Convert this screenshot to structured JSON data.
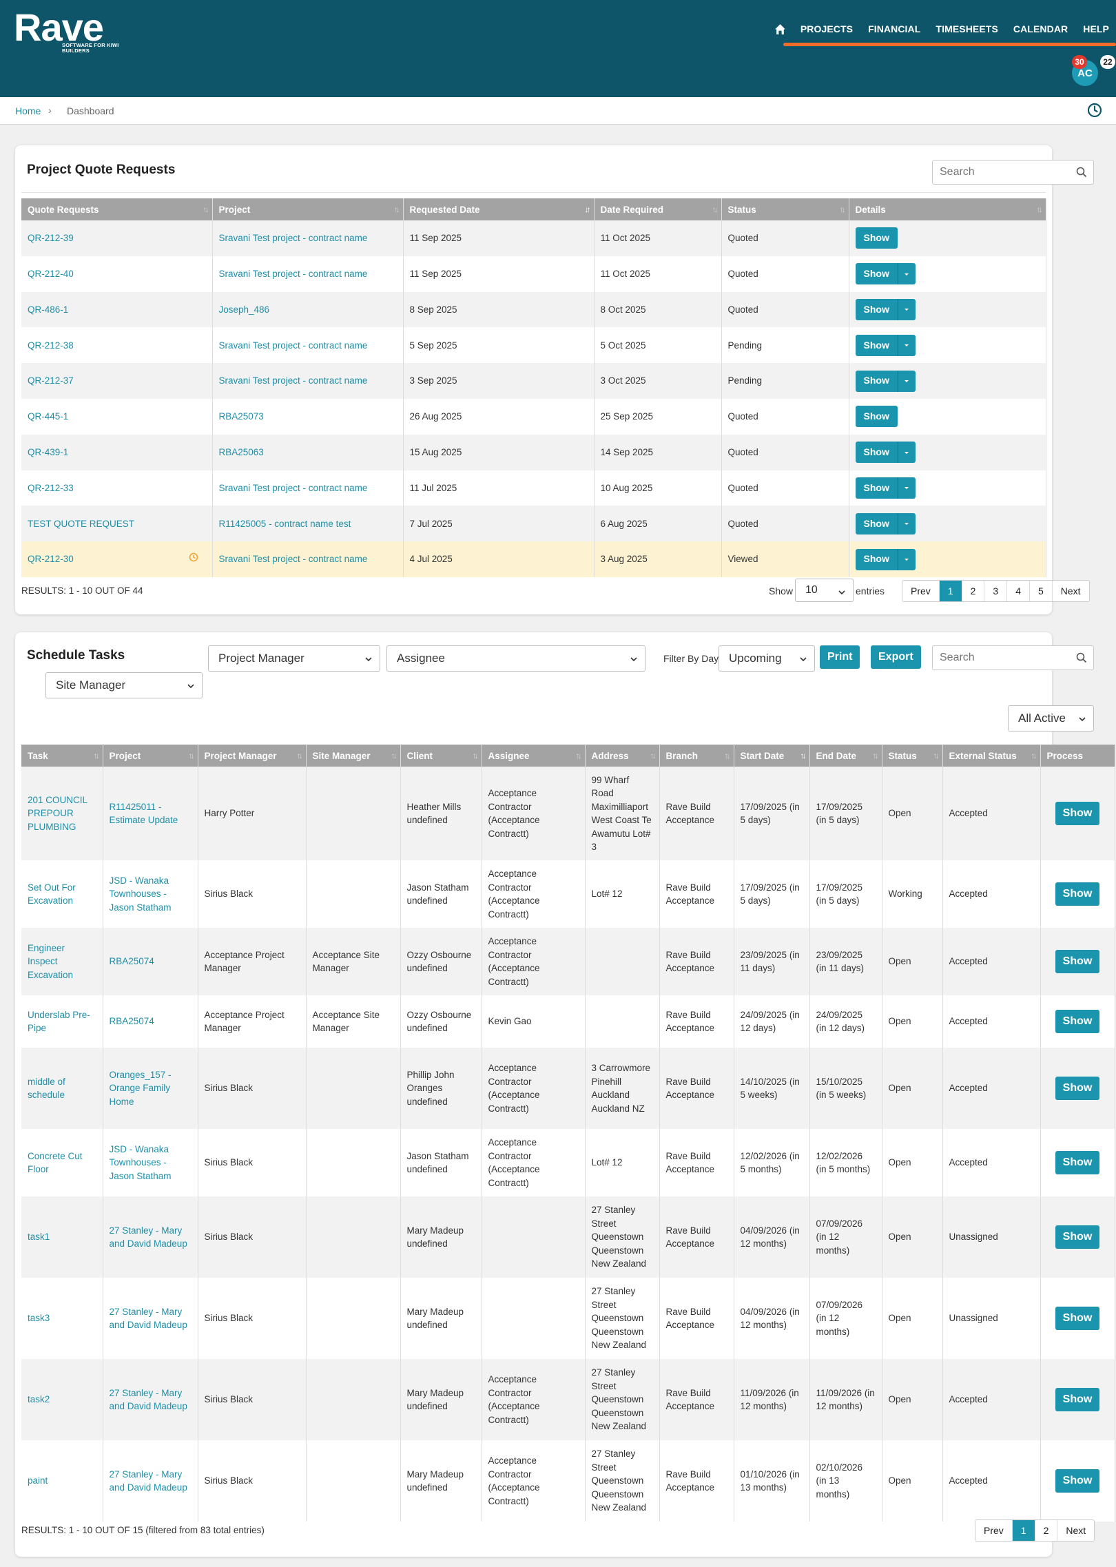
{
  "brand": {
    "name": "Rave",
    "tagline": "SOFTWARE FOR KIWI BUILDERS"
  },
  "nav": {
    "items": [
      "PROJECTS",
      "FINANCIAL",
      "TIMESHEETS",
      "CALENDAR",
      "HELP"
    ]
  },
  "user": {
    "initials": "AC",
    "notifications": "30",
    "messages": "22"
  },
  "breadcrumb": {
    "home": "Home",
    "current": "Dashboard"
  },
  "quotes": {
    "title": "Project Quote Requests",
    "search_placeholder": "Search",
    "columns": [
      "Quote Requests",
      "Project",
      "Requested Date",
      "Date Required",
      "Status",
      "Details"
    ],
    "show_label": "Show",
    "rows": [
      {
        "id": "QR-212-39",
        "project": "Sravani Test project - contract name",
        "requested": "11 Sep 2025",
        "required": "11 Oct 2025",
        "status": "Quoted",
        "caret": false
      },
      {
        "id": "QR-212-40",
        "project": "Sravani Test project - contract name",
        "requested": "11 Sep 2025",
        "required": "11 Oct 2025",
        "status": "Quoted",
        "caret": true
      },
      {
        "id": "QR-486-1",
        "project": "Joseph_486",
        "requested": "8 Sep 2025",
        "required": "8 Oct 2025",
        "status": "Quoted",
        "caret": true
      },
      {
        "id": "QR-212-38",
        "project": "Sravani Test project - contract name",
        "requested": "5 Sep 2025",
        "required": "5 Oct 2025",
        "status": "Pending",
        "caret": true
      },
      {
        "id": "QR-212-37",
        "project": "Sravani Test project - contract name",
        "requested": "3 Sep 2025",
        "required": "3 Oct 2025",
        "status": "Pending",
        "caret": true
      },
      {
        "id": "QR-445-1",
        "project": "RBA25073",
        "requested": "26 Aug 2025",
        "required": "25 Sep 2025",
        "status": "Quoted",
        "caret": false
      },
      {
        "id": "QR-439-1",
        "project": "RBA25063",
        "requested": "15 Aug 2025",
        "required": "14 Sep 2025",
        "status": "Quoted",
        "caret": true
      },
      {
        "id": "QR-212-33",
        "project": "Sravani Test project - contract name",
        "requested": "11 Jul 2025",
        "required": "10 Aug 2025",
        "status": "Quoted",
        "caret": true
      },
      {
        "id": "TEST QUOTE REQUEST",
        "project": "R11425005 - contract name test",
        "requested": "7 Jul 2025",
        "required": "6 Aug 2025",
        "status": "Quoted",
        "caret": true
      },
      {
        "id": "QR-212-30",
        "project": "Sravani Test project - contract name",
        "requested": "4 Jul 2025",
        "required": "3 Aug 2025",
        "status": "Viewed",
        "caret": true,
        "highlight": true,
        "clock": true
      }
    ],
    "results": "RESULTS: 1 - 10 OUT OF 44",
    "show_label_text": "Show",
    "entries_value": "10",
    "entries_label": "entries",
    "pager": [
      "Prev",
      "1",
      "2",
      "3",
      "4",
      "5",
      "Next"
    ],
    "pager_active": "1"
  },
  "tasks": {
    "title": "Schedule Tasks",
    "filters": {
      "project_manager": "Project Manager",
      "assignee": "Assignee",
      "filter_by_days_label": "Filter By Days",
      "days_value": "Upcoming",
      "site_manager": "Site Manager",
      "active_value": "All Active"
    },
    "print_label": "Print",
    "export_label": "Export",
    "search_placeholder": "Search",
    "columns": [
      "Task",
      "Project",
      "Project Manager",
      "Site Manager",
      "Client",
      "Assignee",
      "Address",
      "Branch",
      "Start Date",
      "End Date",
      "Status",
      "External Status",
      "Process"
    ],
    "show_label": "Show",
    "rows": [
      {
        "task": "201 COUNCIL PREPOUR PLUMBING",
        "project": "R11425011 - Estimate Update",
        "pm": "Harry Potter",
        "sm": "",
        "client": "Heather Mills undefined",
        "assignee": "Acceptance Contractor (Acceptance Contractt)",
        "address": "99 Wharf Road Maximilliaport West Coast Te Awamutu Lot# 3",
        "branch": "Rave Build Acceptance",
        "start": "17/09/2025 (in 5 days)",
        "end": "17/09/2025 (in 5 days)",
        "status": "Open",
        "ext": "Accepted"
      },
      {
        "task": "Set Out For Excavation",
        "project": "JSD - Wanaka Townhouses - Jason Statham",
        "pm": "Sirius Black",
        "sm": "",
        "client": "Jason Statham undefined",
        "assignee": "Acceptance Contractor (Acceptance Contractt)",
        "address": "Lot# 12",
        "branch": "Rave Build Acceptance",
        "start": "17/09/2025 (in 5 days)",
        "end": "17/09/2025 (in 5 days)",
        "status": "Working",
        "ext": "Accepted"
      },
      {
        "task": "Engineer Inspect Excavation",
        "project": "RBA25074",
        "pm": "Acceptance Project Manager",
        "sm": "Acceptance Site Manager",
        "client": "Ozzy Osbourne undefined",
        "assignee": "Acceptance Contractor (Acceptance Contractt)",
        "address": "",
        "branch": "Rave Build Acceptance",
        "start": "23/09/2025 (in 11 days)",
        "end": "23/09/2025 (in 11 days)",
        "status": "Open",
        "ext": "Accepted"
      },
      {
        "task": "Underslab Pre-Pipe",
        "project": "RBA25074",
        "pm": "Acceptance Project Manager",
        "sm": "Acceptance Site Manager",
        "client": "Ozzy Osbourne undefined",
        "assignee": "Kevin Gao",
        "address": "",
        "branch": "Rave Build Acceptance",
        "start": "24/09/2025 (in 12 days)",
        "end": "24/09/2025 (in 12 days)",
        "status": "Open",
        "ext": "Accepted"
      },
      {
        "task": "middle of schedule",
        "project": "Oranges_157 - Orange Family Home",
        "pm": "Sirius Black",
        "sm": "",
        "client": "Phillip John Oranges undefined",
        "assignee": "Acceptance Contractor (Acceptance Contractt)",
        "address": "3 Carrowmore Pinehill Auckland Auckland NZ",
        "branch": "Rave Build Acceptance",
        "start": "14/10/2025 (in 5 weeks)",
        "end": "15/10/2025 (in 5 weeks)",
        "status": "Open",
        "ext": "Accepted"
      },
      {
        "task": "Concrete Cut Floor",
        "project": "JSD - Wanaka Townhouses - Jason Statham",
        "pm": "Sirius Black",
        "sm": "",
        "client": "Jason Statham undefined",
        "assignee": "Acceptance Contractor (Acceptance Contractt)",
        "address": "Lot# 12",
        "branch": "Rave Build Acceptance",
        "start": "12/02/2026 (in 5 months)",
        "end": "12/02/2026 (in 5 months)",
        "status": "Open",
        "ext": "Accepted"
      },
      {
        "task": "task1",
        "project": "27 Stanley - Mary and David Madeup",
        "pm": "Sirius Black",
        "sm": "",
        "client": "Mary Madeup undefined",
        "assignee": "",
        "address": "27 Stanley Street Queenstown Queenstown New Zealand",
        "branch": "Rave Build Acceptance",
        "start": "04/09/2026 (in 12 months)",
        "end": "07/09/2026 (in 12 months)",
        "status": "Open",
        "ext": "Unassigned"
      },
      {
        "task": "task3",
        "project": "27 Stanley - Mary and David Madeup",
        "pm": "Sirius Black",
        "sm": "",
        "client": "Mary Madeup undefined",
        "assignee": "",
        "address": "27 Stanley Street Queenstown Queenstown New Zealand",
        "branch": "Rave Build Acceptance",
        "start": "04/09/2026 (in 12 months)",
        "end": "07/09/2026 (in 12 months)",
        "status": "Open",
        "ext": "Unassigned"
      },
      {
        "task": "task2",
        "project": "27 Stanley - Mary and David Madeup",
        "pm": "Sirius Black",
        "sm": "",
        "client": "Mary Madeup undefined",
        "assignee": "Acceptance Contractor (Acceptance Contractt)",
        "address": "27 Stanley Street Queenstown Queenstown New Zealand",
        "branch": "Rave Build Acceptance",
        "start": "11/09/2026 (in 12 months)",
        "end": "11/09/2026 (in 12 months)",
        "status": "Open",
        "ext": "Accepted"
      },
      {
        "task": "paint",
        "project": "27 Stanley - Mary and David Madeup",
        "pm": "Sirius Black",
        "sm": "",
        "client": "Mary Madeup undefined",
        "assignee": "Acceptance Contractor (Acceptance Contractt)",
        "address": "27 Stanley Street Queenstown Queenstown New Zealand",
        "branch": "Rave Build Acceptance",
        "start": "01/10/2026 (in 13 months)",
        "end": "02/10/2026 (in 13 months)",
        "status": "Open",
        "ext": "Accepted"
      }
    ],
    "results": "RESULTS: 1 - 10 OUT OF 15 (filtered from 83 total entries)",
    "pager": [
      "Prev",
      "1",
      "2",
      "Next"
    ],
    "pager_active": "1"
  },
  "colors": {
    "header": "#0e5569",
    "accent": "#1a95ad",
    "nav_underline": "#f06c28",
    "badge": "#e03a2f"
  }
}
